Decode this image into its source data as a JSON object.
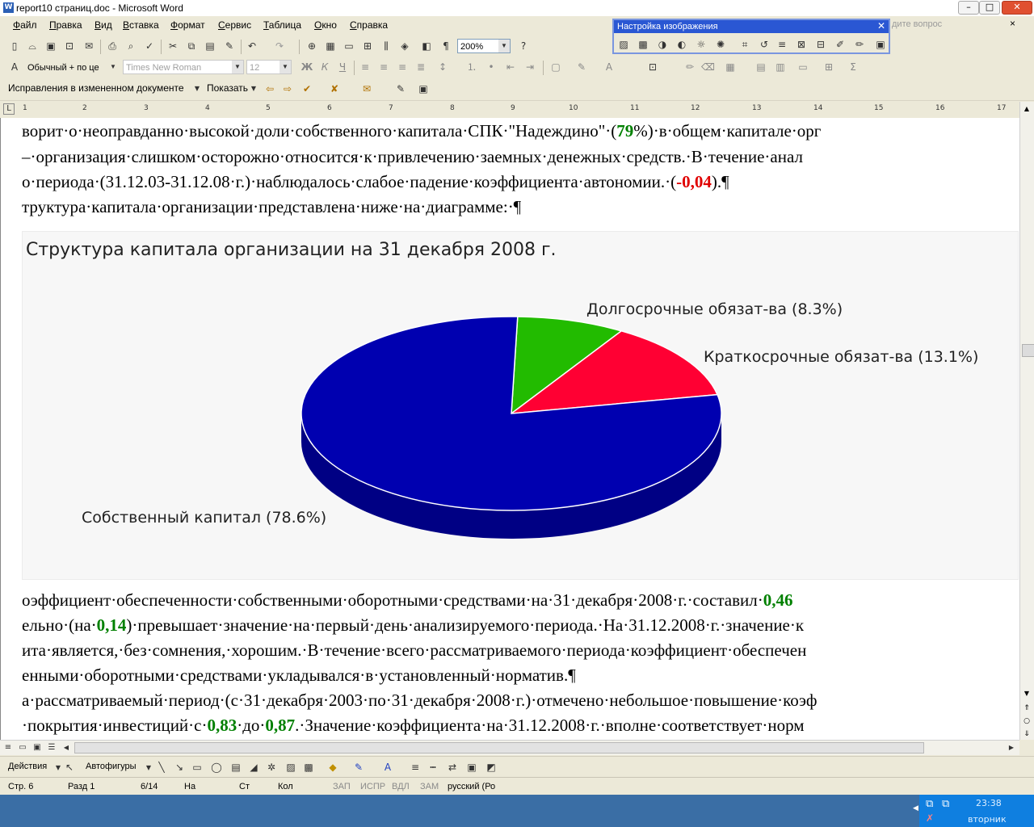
{
  "window": {
    "title": "report10 страниц.doc - Microsoft Word",
    "minimize": "–",
    "maximize": "□",
    "close": "✕"
  },
  "menu": {
    "items": [
      "Файл",
      "Правка",
      "Вид",
      "Вставка",
      "Формат",
      "Сервис",
      "Таблица",
      "Окно",
      "Справка"
    ],
    "help_placeholder": "дите вопрос",
    "help_close": "×"
  },
  "toolbar_formatting": {
    "style_value": "Обычный + по це",
    "font_value": "Times New Roman",
    "size_value": "12",
    "zoom_value": "200%",
    "bold": "Ж",
    "italic": "К",
    "underline": "Ч"
  },
  "toolbar_review": {
    "track_mode": "Исправления в измененном документе",
    "show_label": "Показать"
  },
  "picture_palette": {
    "title": "Настройка изображения"
  },
  "ruler": {
    "numbers": [
      "1",
      "2",
      "3",
      "4",
      "5",
      "6",
      "7",
      "8",
      "9",
      "10",
      "11",
      "12",
      "13",
      "14",
      "15",
      "16",
      "17"
    ]
  },
  "document": {
    "lines_top": [
      [
        {
          "t": "ворит·о·неоправданно·высокой·доли·собственного·капитала·СПК·\"Надеждино\"·("
        },
        {
          "t": "79",
          "c": "g"
        },
        {
          "t": "%)·в·общем·капитале·орг"
        }
      ],
      [
        {
          "t": "–·организация·слишком·осторожно·относится·к·привлечению·заемных·денежных·средств.·В·течение·анал"
        }
      ],
      [
        {
          "t": "о·периода·(31.12.03-31.12.08·г.)·наблюдалось·слабое·падение·коэффициента·автономии.·("
        },
        {
          "t": "-0,04",
          "c": "r"
        },
        {
          "t": ").¶"
        }
      ],
      [
        {
          "t": "труктура·капитала·организации·представлена·ниже·на·диаграмме:·¶"
        }
      ]
    ],
    "lines_bottom": [
      [
        {
          "t": "оэффициент·обеспеченности·собственными·оборотными·средствами·на·31·декабря·2008·г.·составил·"
        },
        {
          "t": "0,46",
          "c": "g"
        }
      ],
      [
        {
          "t": "ельно·(на·"
        },
        {
          "t": "0,14",
          "c": "g"
        },
        {
          "t": ")·превышает·значение·на·первый·день·анализируемого·периода.·На·31.12.2008·г.·значение·к"
        }
      ],
      [
        {
          "t": "ита·является,·без·сомнения,·хорошим.·В·течение·всего·рассматриваемого·периода·коэффициент·обеспечен"
        }
      ],
      [
        {
          "t": "енными·оборотными·средствами·укладывался·в·установленный·норматив.¶"
        }
      ],
      [
        {
          "t": "а·рассматриваемый·период·(с·31·декабря·2003·по·31·декабря·2008·г.)·отмечено·небольшое·повышение·коэф"
        }
      ],
      [
        {
          "t": "·покрытия·инвестиций·с·"
        },
        {
          "t": "0,83",
          "c": "g"
        },
        {
          "t": "·до·"
        },
        {
          "t": "0,87",
          "c": "g"
        },
        {
          "t": ".·Значение·коэффициента·на·31.12.2008·г.·вполне·соответствует·норм"
        }
      ]
    ]
  },
  "chart_data": {
    "type": "pie",
    "title": "Структура капитала организации на 31 декабря 2008 г.",
    "categories": [
      "Собственный капитал",
      "Долгосрочные обязат-ва",
      "Краткосрочные обязат-ва"
    ],
    "values": [
      78.6,
      8.3,
      13.1
    ],
    "labels": [
      "Собственный капитал (78.6%)",
      "Долгосрочные обязат-ва (8.3%)",
      "Краткосрочные обязат-ва (13.1%)"
    ],
    "colors": [
      "#0000b0",
      "#22bb00",
      "#ff0033"
    ],
    "style": "3d",
    "legend": "none"
  },
  "drawing_toolbar": {
    "actions": "Действия",
    "autoshapes": "Автофигуры"
  },
  "status": {
    "page": "Стр. 6",
    "section": "Разд 1",
    "pages": "6/14",
    "at": "На",
    "line": "Ст",
    "col": "Кол",
    "rec": "ЗАП",
    "trk": "ИСПР",
    "ext": "ВДЛ",
    "ovr": "ЗАМ",
    "lang": "русский (Ро"
  },
  "taskbar": {
    "time": "23:38",
    "day": "вторник"
  }
}
